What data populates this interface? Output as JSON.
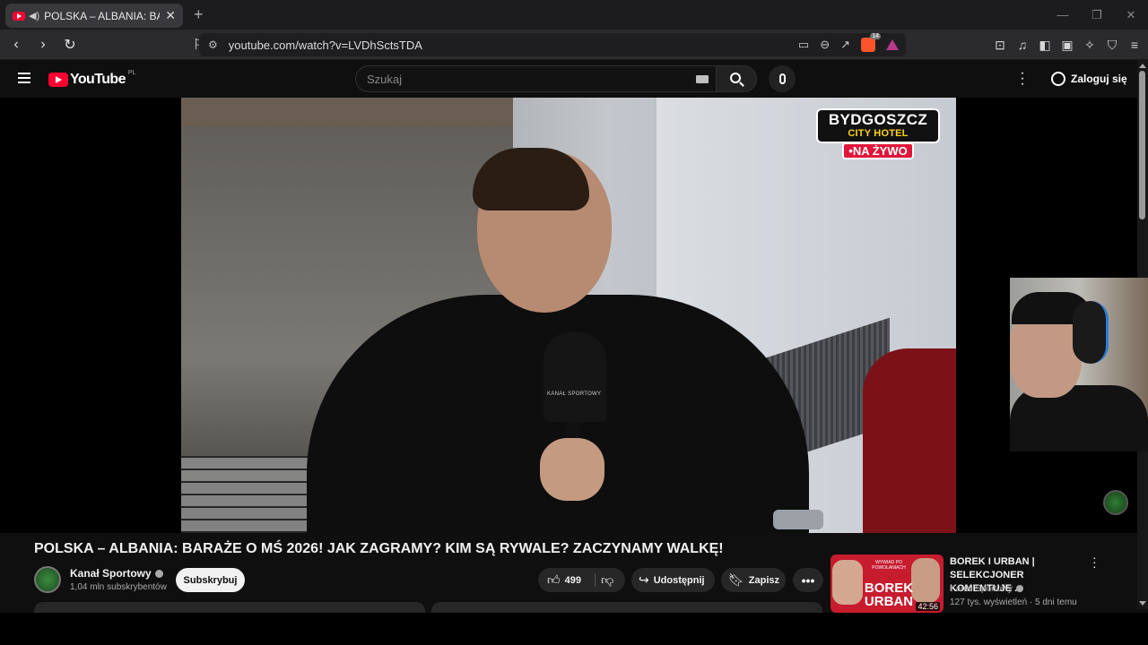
{
  "browser": {
    "tab_title": "POLSKA – ALBANIA: BARAŻE",
    "url": "youtube.com/watch?v=LVDhSctsTDA",
    "brave_count": "14"
  },
  "youtube": {
    "logo_text": "YouTube",
    "country_code": "PL",
    "search_placeholder": "Szukaj",
    "login_label": "Zaloguj się"
  },
  "overlay": {
    "line1": "BYDGOSZCZ",
    "line2": "CITY HOTEL",
    "live": "NA ŻYWO",
    "mic_logo": "KANAŁ SPORTOWY"
  },
  "video": {
    "title": "POLSKA – ALBANIA: BARAŻE O MŚ 2026! JAK ZAGRAMY? KIM SĄ RYWALE? ZACZYNAMY WALKĘ!",
    "channel": "Kanał Sportowy",
    "subscribers": "1,04 mln subskrybentów",
    "subscribe_label": "Subskrybuj",
    "likes": "499",
    "share_label": "Udostępnij",
    "save_label": "Zapisz"
  },
  "recommended": [
    {
      "title": "BOREK I URBAN | SELEKCJONER KOMENTUJE ...",
      "channel": "Kanał Sportowy",
      "meta": "127 tys. wyświetleń · 5 dni temu",
      "duration": "42:56",
      "thumb_small_text": "WYWIAD PO POWOŁANIACH",
      "thumb_big_text": "BOREK URBAN"
    }
  ],
  "colors": {
    "youtube_red": "#ff0033",
    "live_red": "#e0163a",
    "overlay_yellow": "#ffd21c"
  }
}
